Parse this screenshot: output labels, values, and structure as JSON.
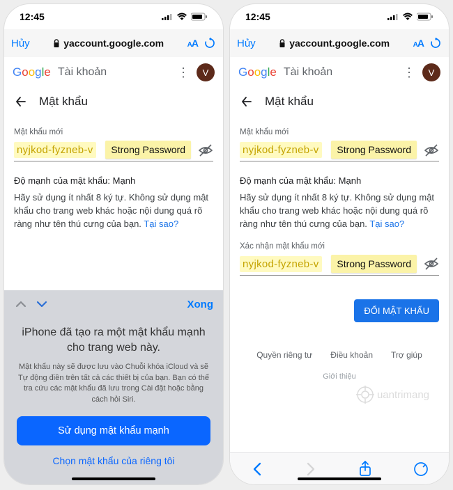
{
  "status": {
    "time": "12:45"
  },
  "addr": {
    "cancel": "Hủy",
    "url": "yaccount.google.com"
  },
  "appbar": {
    "account": "Tài khoản",
    "avatar": "V"
  },
  "subbar": {
    "title": "Mật khẩu"
  },
  "field": {
    "label_new": "Mật khẩu mới",
    "label_confirm": "Xác nhận mật khẩu mới",
    "value": "nyjkod-fyzneb-v",
    "strong_badge": "Strong Password"
  },
  "strength": {
    "label": "Độ mạnh của mật khẩu:",
    "value": "Mạnh"
  },
  "hint": "Hãy sử dụng ít nhất 8 ký tự. Không sử dụng mật khẩu cho trang web khác hoặc nội dung quá rõ ràng như tên thú cưng của bạn.",
  "why": "Tại sao?",
  "change_btn": "ĐỔI MẬT KHẨU",
  "footer": {
    "privacy": "Quyền riêng tư",
    "terms": "Điều khoản",
    "help": "Trợ giúp",
    "intro": "Giới thiệu"
  },
  "kb": {
    "done": "Xong",
    "title1": "iPhone đã tạo ra một mật khẩu mạnh",
    "title2": "cho trang web này.",
    "desc": "Mật khẩu này sẽ được lưu vào Chuỗi khóa iCloud và sẽ Tự động điền trên tất cả các thiết bị của bạn. Bạn có thể tra cứu các mật khẩu đã lưu trong Cài đặt hoặc bằng cách hỏi Siri.",
    "use_btn": "Sử dụng mật khẩu mạnh",
    "own_link": "Chọn mật khẩu của riêng tôi"
  },
  "watermark": "uantrimang"
}
